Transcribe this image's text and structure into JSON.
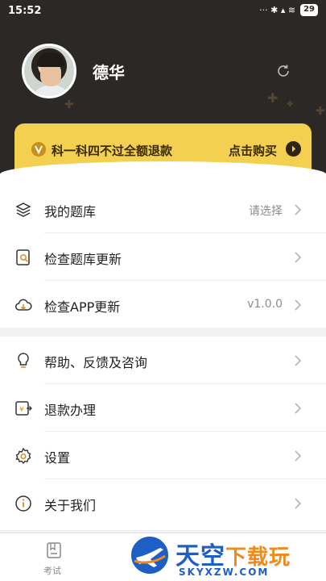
{
  "status_bar": {
    "time": "15:52",
    "icons": "··· ✱ ▴ ≋",
    "battery": "29"
  },
  "profile": {
    "name": "德华",
    "refresh_icon": "refresh-icon"
  },
  "banner": {
    "icon": "v-badge-icon",
    "text": "科一科四不过全额退款",
    "action": "点击购买"
  },
  "menu_group1": [
    {
      "icon": "layers-icon",
      "label": "我的题库",
      "value": "请选择"
    },
    {
      "icon": "search-doc-icon",
      "label": "检查题库更新",
      "value": ""
    },
    {
      "icon": "cloud-download-icon",
      "label": "检查APP更新",
      "value": "v1.0.0"
    }
  ],
  "menu_group2": [
    {
      "icon": "lightbulb-icon",
      "label": "帮助、反馈及咨询"
    },
    {
      "icon": "refund-icon",
      "label": "退款办理"
    },
    {
      "icon": "gear-icon",
      "label": "设置"
    },
    {
      "icon": "info-icon",
      "label": "关于我们"
    }
  ],
  "bottom_nav": {
    "exam_label": "考试"
  },
  "watermark": {
    "title_a": "天空",
    "title_b": "下载玩",
    "url": "SKYXZW.COM"
  },
  "colors": {
    "header_bg": "#2b2826",
    "banner_bg": "#f3d04f",
    "watermark_blue": "#1d5fc4",
    "watermark_orange": "#f08a1c"
  }
}
